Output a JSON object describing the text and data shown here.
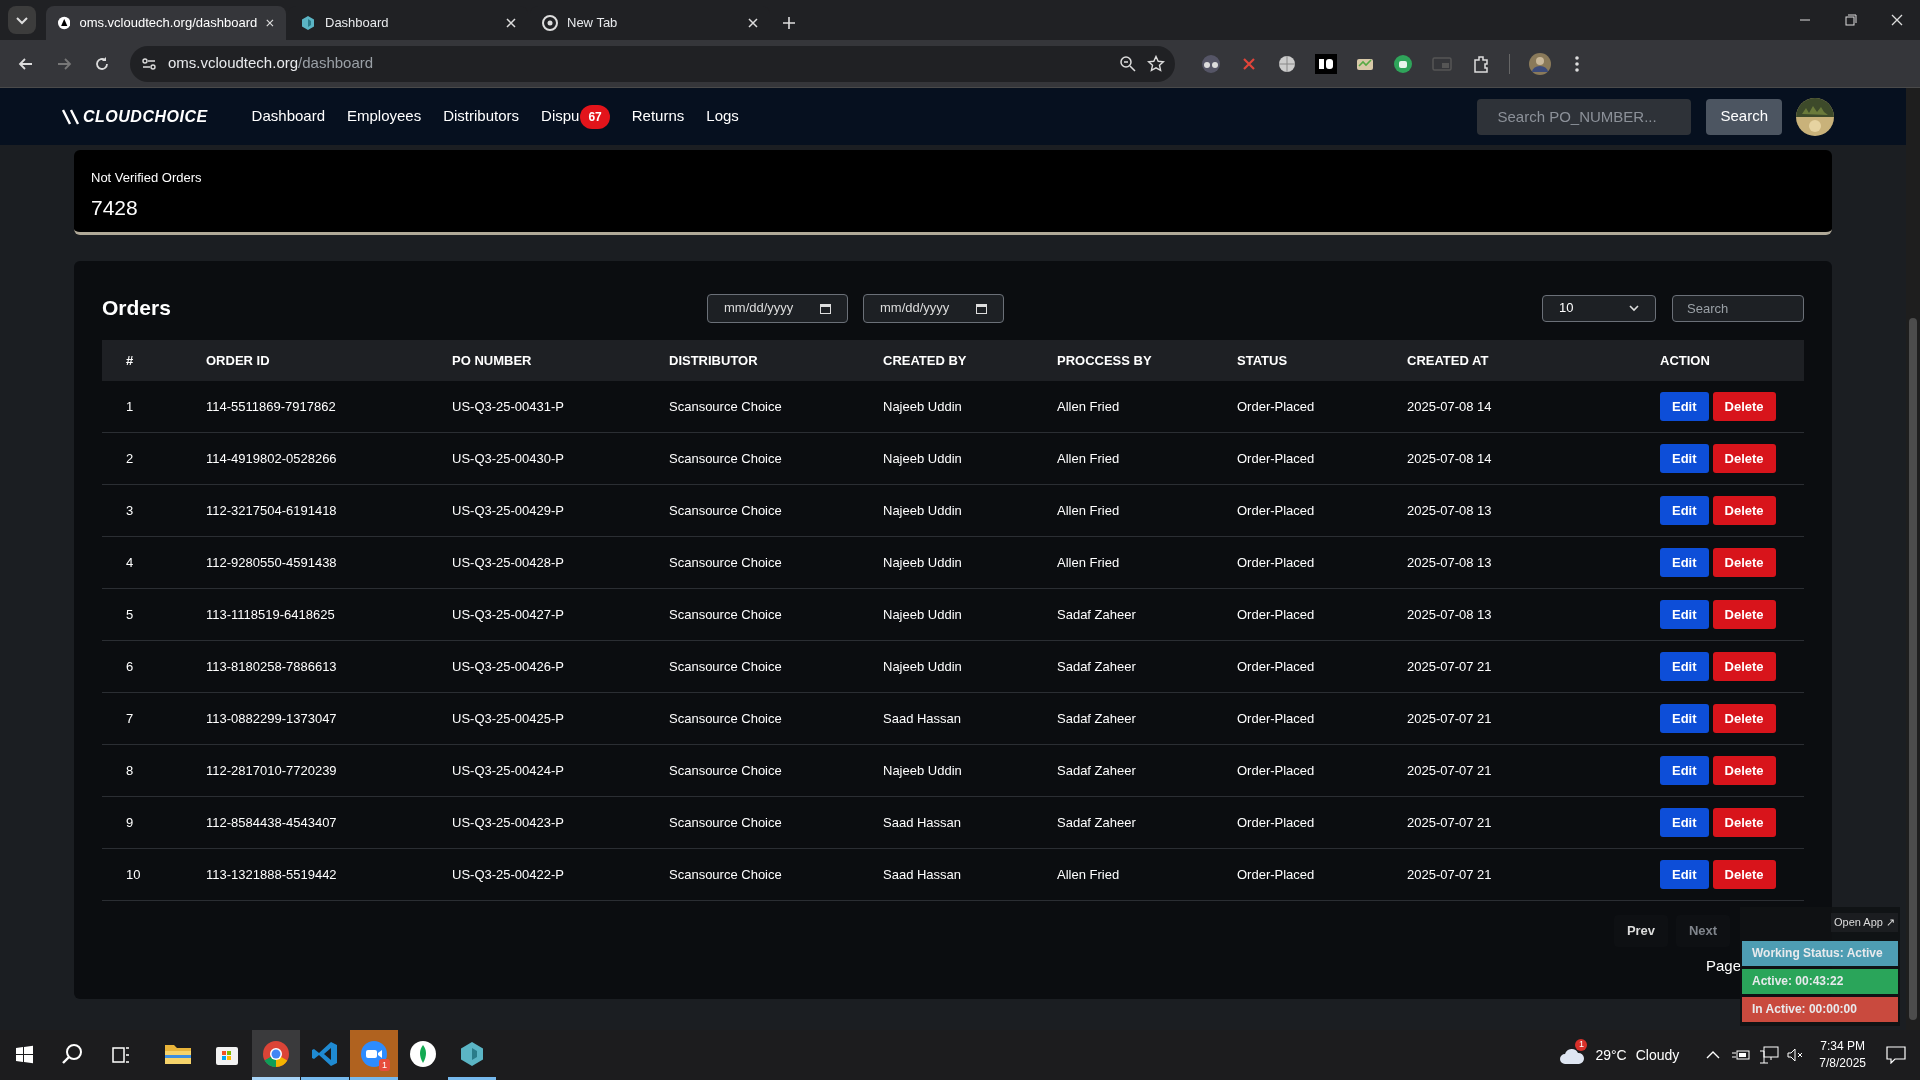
{
  "browser": {
    "tabs": [
      {
        "title": "oms.vcloudtech.org/dashboard",
        "selected": true,
        "kind": "site"
      },
      {
        "title": "Dashboard",
        "selected": false,
        "kind": "app"
      },
      {
        "title": "New Tab",
        "selected": false,
        "kind": "chrome"
      }
    ],
    "address": {
      "host": "oms.vcloudtech.org",
      "path": "/dashboard"
    }
  },
  "nav": {
    "logo": "CLOUDCHOICE",
    "items": [
      {
        "label": "Dashboard"
      },
      {
        "label": "Employees"
      },
      {
        "label": "Distributors"
      },
      {
        "label": "Dispu",
        "badge": "67"
      },
      {
        "label": "Returns"
      },
      {
        "label": "Logs"
      }
    ],
    "search": {
      "placeholder": "Search PO_NUMBER..."
    },
    "search_button": "Search"
  },
  "stat_card": {
    "label": "Not Verified Orders",
    "value": "7428"
  },
  "orders": {
    "title": "Orders",
    "date_from": {
      "placeholder": "mm/dd/yyyy"
    },
    "date_to": {
      "placeholder": "mm/dd/yyyy"
    },
    "page_size": "10",
    "search": {
      "placeholder": "Search"
    },
    "columns": [
      "#",
      "ORDER ID",
      "PO NUMBER",
      "DISTRIBUTOR",
      "CREATED BY",
      "PROCCESS BY",
      "STATUS",
      "CREATED AT",
      "ACTION"
    ],
    "rows": [
      {
        "cells": [
          "1",
          "114-5511869-7917862",
          "US-Q3-25-00431-P",
          "Scansource Choice",
          "Najeeb Uddin",
          "Allen Fried",
          "Order-Placed",
          "2025-07-08 14"
        ],
        "edit": "Edit",
        "delete": "Delete"
      },
      {
        "cells": [
          "2",
          "114-4919802-0528266",
          "US-Q3-25-00430-P",
          "Scansource Choice",
          "Najeeb Uddin",
          "Allen Fried",
          "Order-Placed",
          "2025-07-08 14"
        ],
        "edit": "Edit",
        "delete": "Delete"
      },
      {
        "cells": [
          "3",
          "112-3217504-6191418",
          "US-Q3-25-00429-P",
          "Scansource Choice",
          "Najeeb Uddin",
          "Allen Fried",
          "Order-Placed",
          "2025-07-08 13"
        ],
        "edit": "Edit",
        "delete": "Delete"
      },
      {
        "cells": [
          "4",
          "112-9280550-4591438",
          "US-Q3-25-00428-P",
          "Scansource Choice",
          "Najeeb Uddin",
          "Allen Fried",
          "Order-Placed",
          "2025-07-08 13"
        ],
        "edit": "Edit",
        "delete": "Delete"
      },
      {
        "cells": [
          "5",
          "113-1118519-6418625",
          "US-Q3-25-00427-P",
          "Scansource Choice",
          "Najeeb Uddin",
          "Sadaf Zaheer",
          "Order-Placed",
          "2025-07-08 13"
        ],
        "edit": "Edit",
        "delete": "Delete"
      },
      {
        "cells": [
          "6",
          "113-8180258-7886613",
          "US-Q3-25-00426-P",
          "Scansource Choice",
          "Najeeb Uddin",
          "Sadaf Zaheer",
          "Order-Placed",
          "2025-07-07 21"
        ],
        "edit": "Edit",
        "delete": "Delete"
      },
      {
        "cells": [
          "7",
          "113-0882299-1373047",
          "US-Q3-25-00425-P",
          "Scansource Choice",
          "Saad Hassan",
          "Sadaf Zaheer",
          "Order-Placed",
          "2025-07-07 21"
        ],
        "edit": "Edit",
        "delete": "Delete"
      },
      {
        "cells": [
          "8",
          "112-2817010-7720239",
          "US-Q3-25-00424-P",
          "Scansource Choice",
          "Najeeb Uddin",
          "Sadaf Zaheer",
          "Order-Placed",
          "2025-07-07 21"
        ],
        "edit": "Edit",
        "delete": "Delete"
      },
      {
        "cells": [
          "9",
          "112-8584438-4543407",
          "US-Q3-25-00423-P",
          "Scansource Choice",
          "Saad Hassan",
          "Sadaf Zaheer",
          "Order-Placed",
          "2025-07-07 21"
        ],
        "edit": "Edit",
        "delete": "Delete"
      },
      {
        "cells": [
          "10",
          "113-1321888-5519442",
          "US-Q3-25-00422-P",
          "Scansource Choice",
          "Saad Hassan",
          "Allen Fried",
          "Order-Placed",
          "2025-07-07 21"
        ],
        "edit": "Edit",
        "delete": "Delete"
      }
    ],
    "pagination": {
      "prev": {
        "label": "Prev",
        "disabled": false
      },
      "next": {
        "label": "Next",
        "disabled": true
      },
      "page_label": "Page"
    }
  },
  "tracker": {
    "open_app": "Open App ↗",
    "statuses": [
      {
        "text": "Working Status: Active",
        "color": "#4e9db3"
      },
      {
        "text": "Active: 00:43:22",
        "color": "#2aa55a"
      },
      {
        "text": "In Active: 00:00:00",
        "color": "#c94a3e"
      }
    ]
  },
  "taskbar": {
    "apps": [
      {
        "kind": "explorer",
        "running": false,
        "selected": false,
        "flashing": false
      },
      {
        "kind": "store",
        "running": false,
        "selected": false,
        "flashing": false
      },
      {
        "kind": "chrome",
        "running": true,
        "selected": true,
        "flashing": false
      },
      {
        "kind": "vscode",
        "running": true,
        "selected": false,
        "flashing": false
      },
      {
        "kind": "zoom",
        "running": true,
        "selected": false,
        "flashing": true,
        "badge": "1"
      },
      {
        "kind": "mongo",
        "running": false,
        "selected": false,
        "flashing": false
      },
      {
        "kind": "app",
        "running": true,
        "selected": false,
        "flashing": false
      }
    ],
    "weather": {
      "badge": "1",
      "temp": "29°C",
      "condition": "Cloudy"
    },
    "time": "7:34 PM",
    "date": "7/8/2025"
  }
}
